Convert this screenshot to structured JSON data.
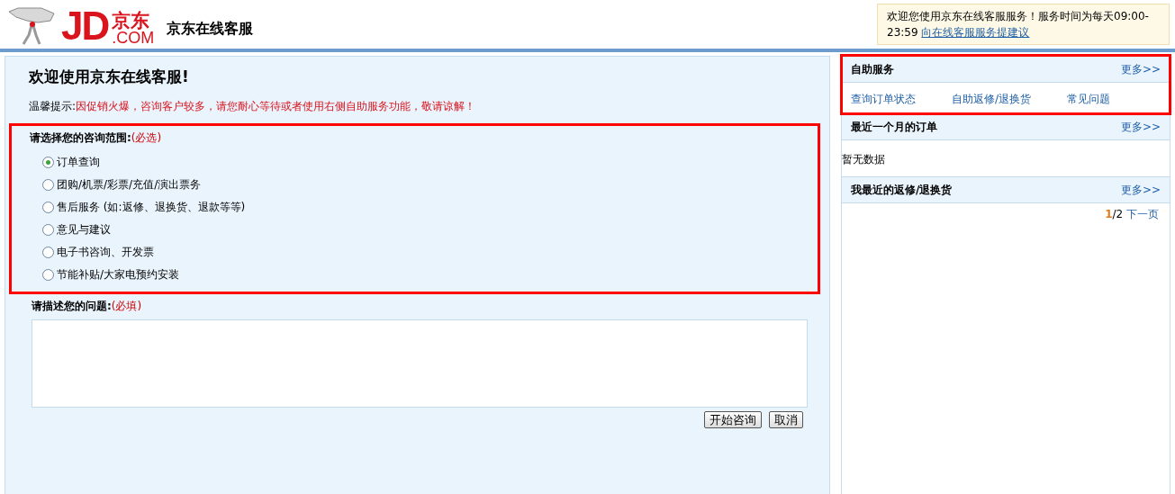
{
  "header": {
    "logo": {
      "mark": "JD",
      "cn": "京东",
      "domain": ".COM"
    },
    "title": "京东在线客服",
    "notice": {
      "text": "欢迎您使用京东在线客服服务！服务时间为每天09:00-23:59",
      "link": "向在线客服服务提建议"
    }
  },
  "main": {
    "heading": "欢迎使用京东在线客服!",
    "tip_label": "温馨提示:",
    "tip": "因促销火爆，咨询客户较多，请您耐心等待或者使用右侧自助服务功能，敬请谅解！",
    "scope": {
      "highlighted": true,
      "label": "请选择您的咨询范围:",
      "required": "(必选)",
      "options": [
        {
          "label": "订单查询",
          "selected": true
        },
        {
          "label": "团购/机票/彩票/充值/演出票务",
          "selected": false
        },
        {
          "label": "售后服务 (如:返修、退换货、退款等等)",
          "selected": false
        },
        {
          "label": "意见与建议",
          "selected": false
        },
        {
          "label": "电子书咨询、开发票",
          "selected": false
        },
        {
          "label": "节能补贴/大家电预约安装",
          "selected": false
        }
      ]
    },
    "question": {
      "label": "请描述您的问题:",
      "required": "(必填)"
    },
    "buttons": [
      "开始咨询",
      "取消"
    ]
  },
  "sidebar": [
    {
      "title": "自助服务",
      "more": "更多>>",
      "highlighted": true,
      "links": [
        "查询订单状态",
        "自助返修/退换货",
        "常见问题"
      ]
    },
    {
      "title": "最近一个月的订单",
      "more": "更多>>",
      "highlighted": false,
      "empty": "暂无数据"
    },
    {
      "title": "我最近的返修/退换货",
      "more": "更多>>",
      "highlighted": false,
      "pager": {
        "current": "1",
        "total": "/2",
        "next": "下一页"
      }
    }
  ]
}
